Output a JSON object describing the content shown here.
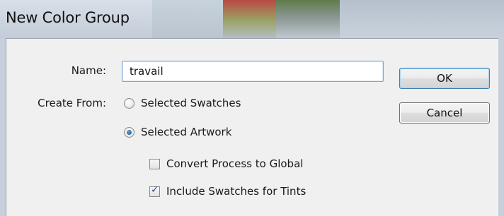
{
  "window": {
    "title": "New Color Group"
  },
  "form": {
    "name_label": "Name:",
    "name_value": "travail",
    "create_from_label": "Create From:",
    "options": [
      {
        "label": "Selected Swatches",
        "checked": false
      },
      {
        "label": "Selected Artwork",
        "checked": true
      }
    ],
    "checkboxes": [
      {
        "label": "Convert Process to Global",
        "checked": false
      },
      {
        "label": "Include Swatches for Tints",
        "checked": true
      }
    ]
  },
  "buttons": {
    "ok": "OK",
    "cancel": "Cancel"
  },
  "icons": {
    "check": "check-icon"
  }
}
